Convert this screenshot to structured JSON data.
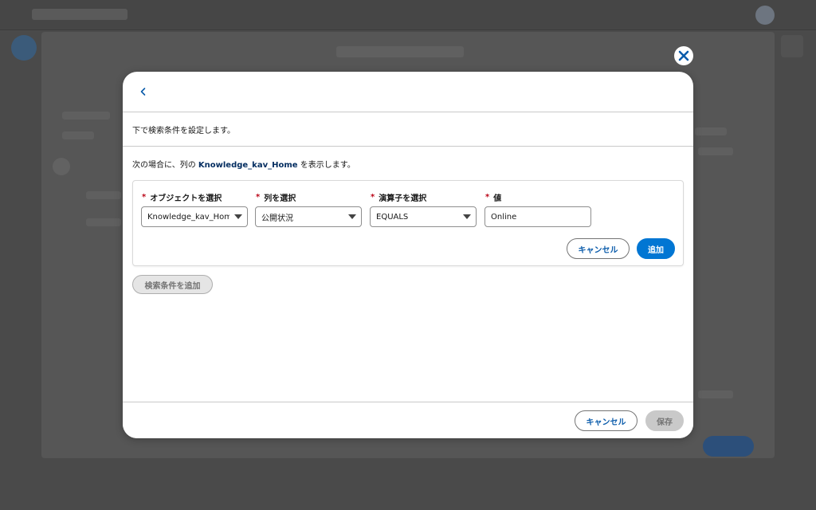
{
  "modal": {
    "back_icon": "chevron-left-icon",
    "close_icon": "close-icon",
    "instruction": "下で検索条件を設定します。",
    "sentence": {
      "prefix": "次の場合に、列の ",
      "column": "Knowledge_kav_Home",
      "suffix": " を表示します。"
    },
    "filter": {
      "object_label": "オブジェクトを選択",
      "object_value": "Knowledge_kav_Home",
      "column_label": "列を選択",
      "column_value": "公開状況",
      "operator_label": "演算子を選択",
      "operator_value": "EQUALS",
      "value_label": "値",
      "value_value": "Online",
      "required_mark": "*",
      "cancel_label": "キャンセル",
      "add_label": "追加"
    },
    "add_filter_label": "検索条件を追加",
    "footer": {
      "cancel_label": "キャンセル",
      "save_label": "保存"
    }
  },
  "colors": {
    "brand": "#0176d3",
    "link": "#0b5cab",
    "required": "#ba0517",
    "overlay": "#3f3f3f"
  }
}
